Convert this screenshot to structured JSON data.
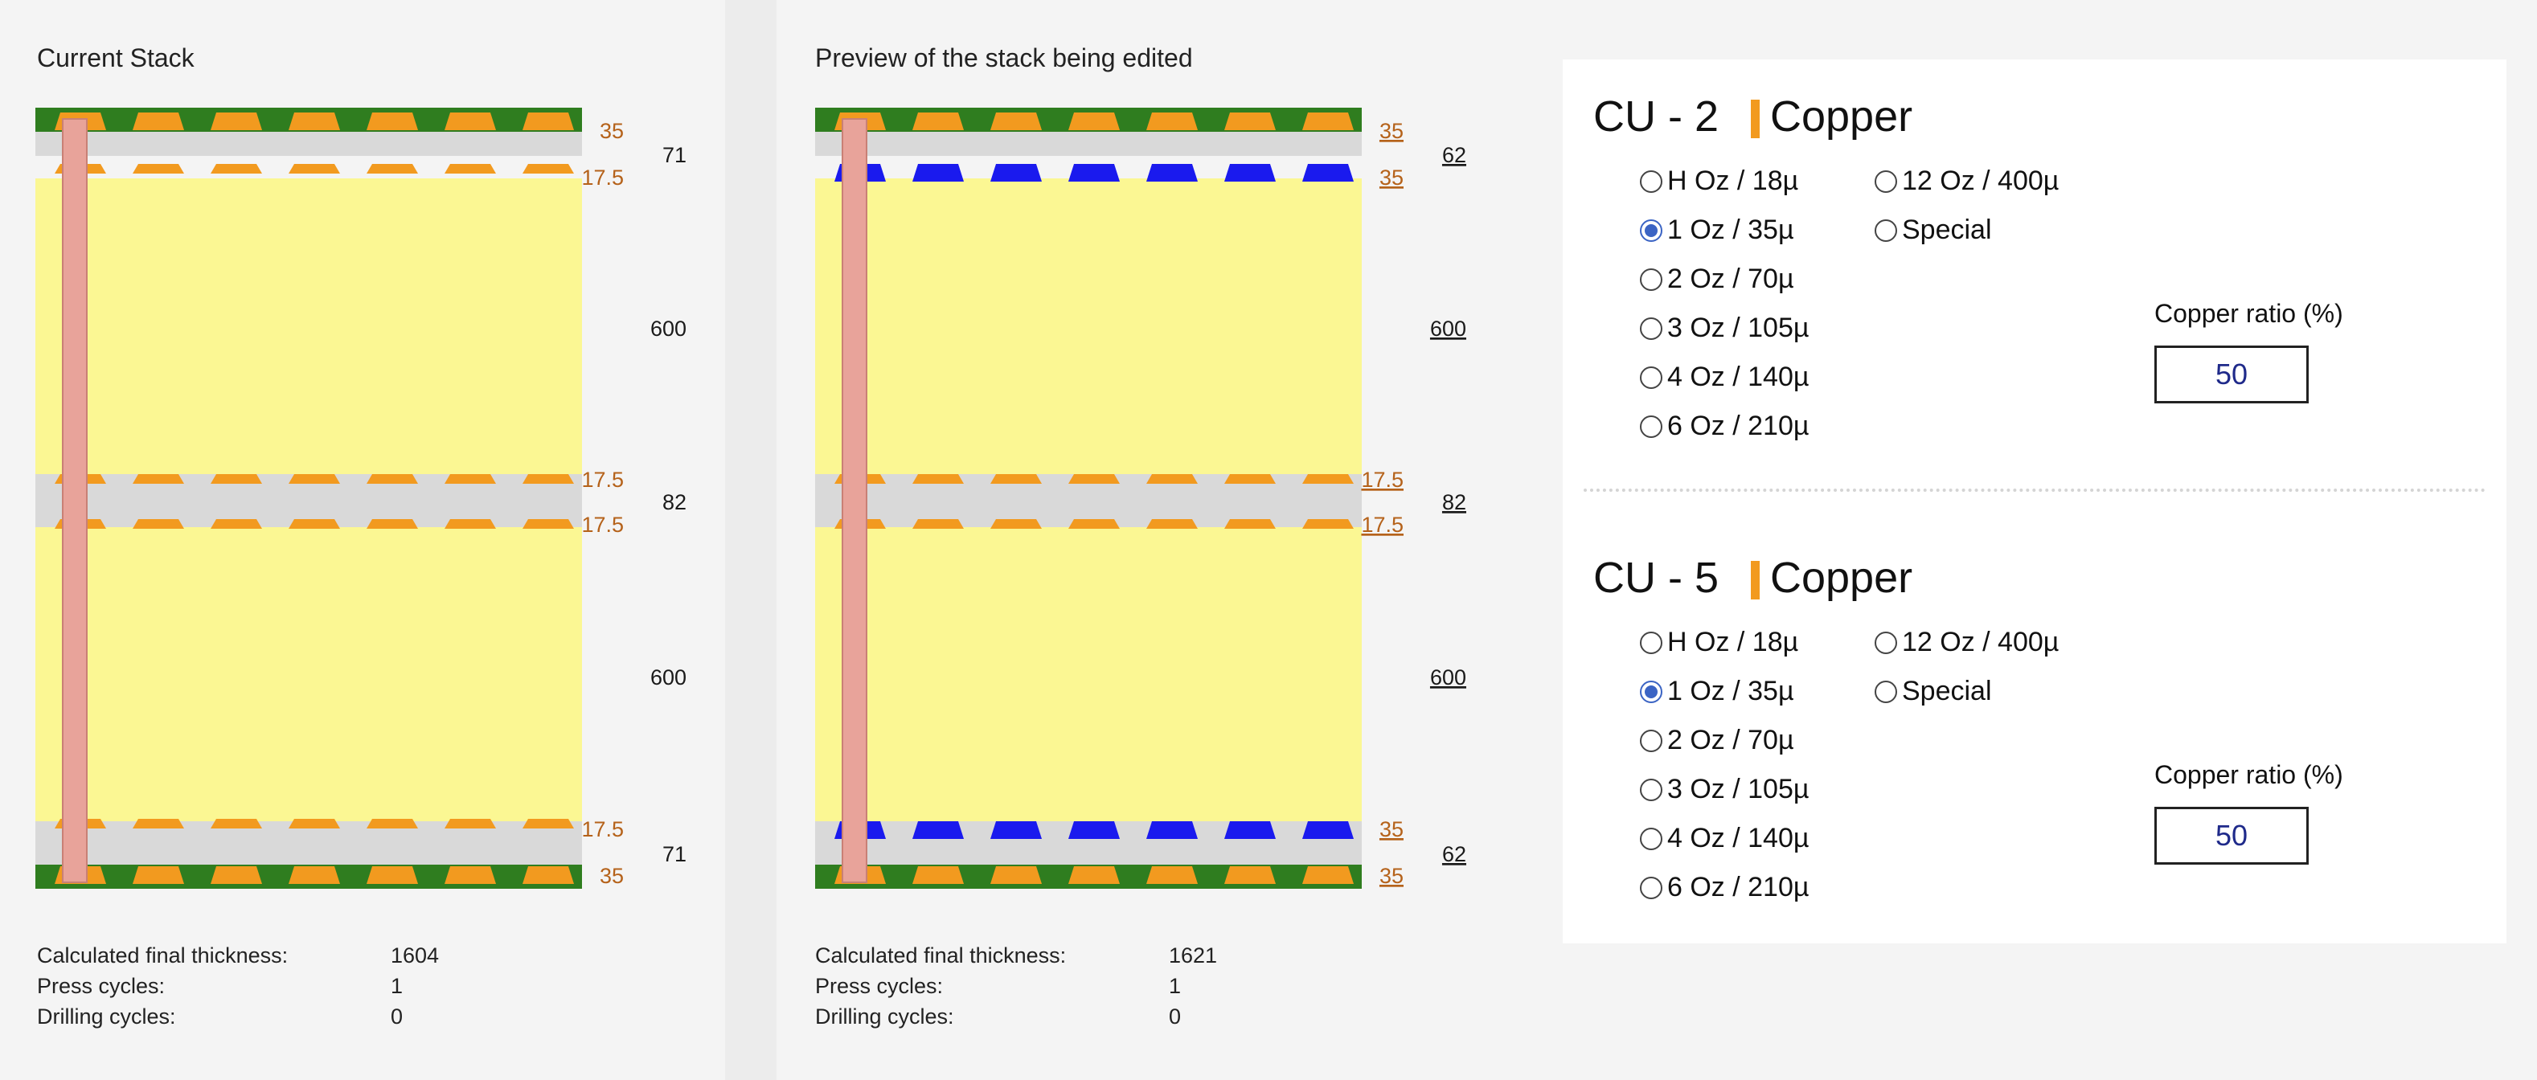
{
  "current": {
    "title": "Current Stack",
    "layer_labels": [
      "35",
      "17.5",
      "17.5",
      "17.5",
      "17.5",
      "35"
    ],
    "group_labels": [
      "71",
      "600",
      "82",
      "600",
      "71"
    ],
    "info": [
      {
        "label": "Calculated final thickness:",
        "value": "1604"
      },
      {
        "label": "Press cycles:",
        "value": "1"
      },
      {
        "label": "Drilling cycles:",
        "value": "0"
      }
    ]
  },
  "preview": {
    "title": "Preview of the stack being edited",
    "layer_labels": [
      "35",
      "35",
      "17.5",
      "17.5",
      "35",
      "35"
    ],
    "group_labels": [
      "62",
      "600",
      "82",
      "600",
      "62"
    ],
    "info": [
      {
        "label": "Calculated final thickness:",
        "value": "1621"
      },
      {
        "label": "Press cycles:",
        "value": "1"
      },
      {
        "label": "Drilling cycles:",
        "value": "0"
      }
    ]
  },
  "sections": [
    {
      "name": "CU - 2",
      "material": "Copper",
      "options_left": [
        "H Oz / 18µ",
        "1 Oz / 35µ",
        "2 Oz / 70µ",
        "3 Oz / 105µ",
        "4 Oz / 140µ",
        "6 Oz / 210µ"
      ],
      "options_right": [
        "12 Oz / 400µ",
        "Special"
      ],
      "selected": "1 Oz / 35µ",
      "ratio_label": "Copper ratio (%)",
      "ratio_value": "50"
    },
    {
      "name": "CU - 5",
      "material": "Copper",
      "options_left": [
        "H Oz / 18µ",
        "1 Oz / 35µ",
        "2 Oz / 70µ",
        "3 Oz / 105µ",
        "4 Oz / 140µ",
        "6 Oz / 210µ"
      ],
      "options_right": [
        "12 Oz / 400µ",
        "Special"
      ],
      "selected": "1 Oz / 35µ",
      "ratio_label": "Copper ratio (%)",
      "ratio_value": "50"
    }
  ],
  "colors": {
    "solder_mask": "#2f7d1f",
    "copper_current": "#f29a1f",
    "copper_edited": "#1a1aee",
    "prepreg": "#d9d9d9",
    "core": "#fbf793",
    "via": "#e8a39a",
    "label_orange": "#b5621a",
    "accent": "#f29a1f"
  }
}
